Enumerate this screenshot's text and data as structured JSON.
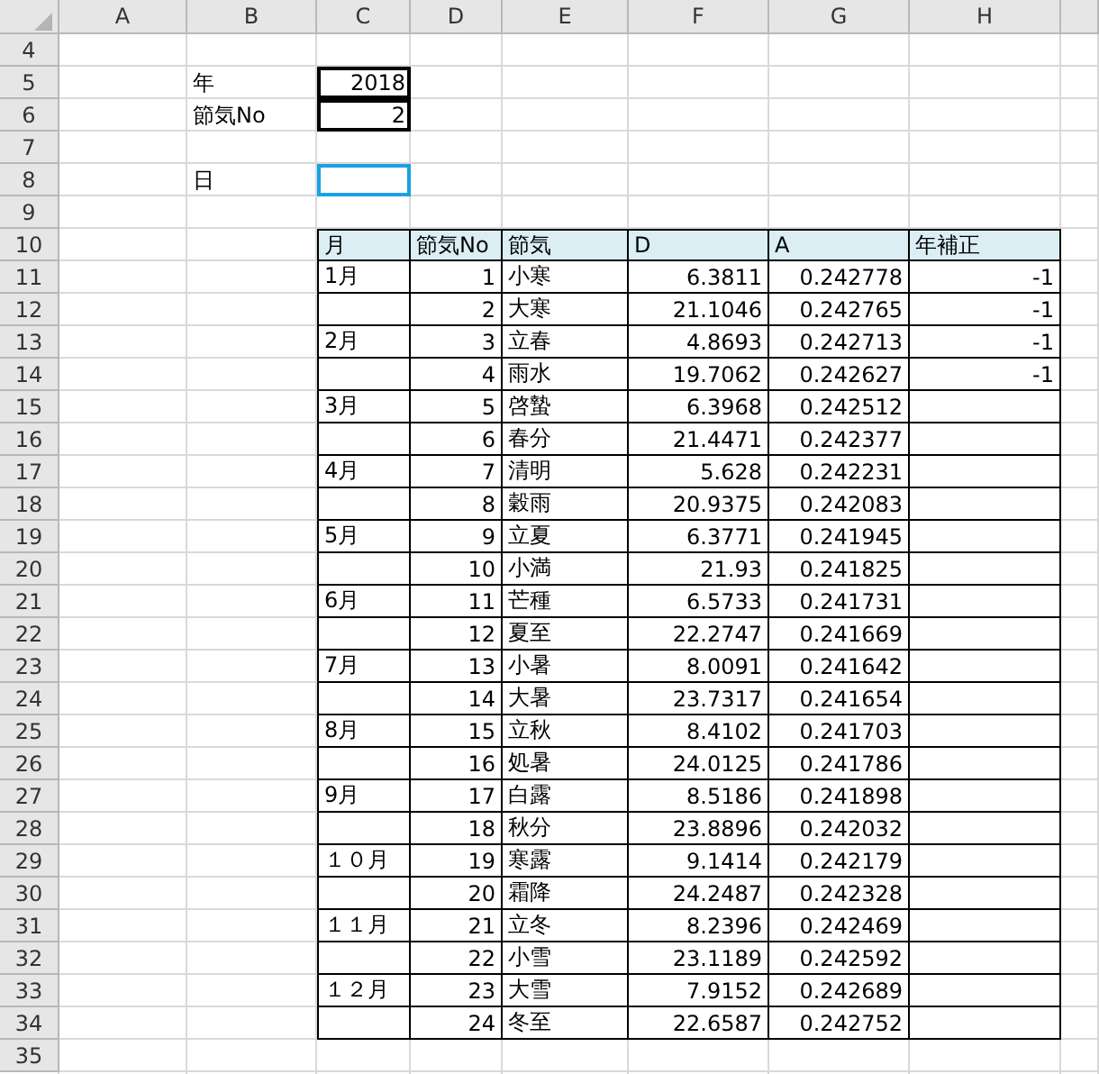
{
  "columns": [
    "A",
    "B",
    "C",
    "D",
    "E",
    "F",
    "G",
    "H"
  ],
  "row_numbers": [
    "4",
    "5",
    "6",
    "7",
    "8",
    "9",
    "10",
    "11",
    "12",
    "13",
    "14",
    "15",
    "16",
    "17",
    "18",
    "19",
    "20",
    "21",
    "22",
    "23",
    "24",
    "25",
    "26",
    "27",
    "28",
    "29",
    "30",
    "31",
    "32",
    "33",
    "34",
    "35"
  ],
  "inputs": [
    {
      "label": "年",
      "value": "2018"
    },
    {
      "label": "節気No",
      "value": "2"
    }
  ],
  "day": {
    "label": "日",
    "selected": true
  },
  "table": {
    "columns": [
      "月",
      "節気No",
      "節気",
      "D",
      "A",
      "年補正"
    ],
    "rows": [
      {
        "month": "1月",
        "no": "1",
        "name": "小寒",
        "d": "6.3811",
        "a": "0.242778",
        "year_correction": "-1"
      },
      {
        "no": "2",
        "name": "大寒",
        "d": "21.1046",
        "a": "0.242765",
        "year_correction": "-1"
      },
      {
        "month": "2月",
        "no": "3",
        "name": "立春",
        "d": "4.8693",
        "a": "0.242713",
        "year_correction": "-1"
      },
      {
        "no": "4",
        "name": "雨水",
        "d": "19.7062",
        "a": "0.242627",
        "year_correction": "-1"
      },
      {
        "month": "3月",
        "no": "5",
        "name": "啓蟄",
        "d": "6.3968",
        "a": "0.242512"
      },
      {
        "no": "6",
        "name": "春分",
        "d": "21.4471",
        "a": "0.242377"
      },
      {
        "month": "4月",
        "no": "7",
        "name": "清明",
        "d": "5.628",
        "a": "0.242231"
      },
      {
        "no": "8",
        "name": "穀雨",
        "d": "20.9375",
        "a": "0.242083"
      },
      {
        "month": "5月",
        "no": "9",
        "name": "立夏",
        "d": "6.3771",
        "a": "0.241945"
      },
      {
        "no": "10",
        "name": "小満",
        "d": "21.93",
        "a": "0.241825"
      },
      {
        "month": "6月",
        "no": "11",
        "name": "芒種",
        "d": "6.5733",
        "a": "0.241731"
      },
      {
        "no": "12",
        "name": "夏至",
        "d": "22.2747",
        "a": "0.241669"
      },
      {
        "month": "7月",
        "no": "13",
        "name": "小暑",
        "d": "8.0091",
        "a": "0.241642"
      },
      {
        "no": "14",
        "name": "大暑",
        "d": "23.7317",
        "a": "0.241654"
      },
      {
        "month": "8月",
        "no": "15",
        "name": "立秋",
        "d": "8.4102",
        "a": "0.241703"
      },
      {
        "no": "16",
        "name": "処暑",
        "d": "24.0125",
        "a": "0.241786"
      },
      {
        "month": "9月",
        "no": "17",
        "name": "白露",
        "d": "8.5186",
        "a": "0.241898"
      },
      {
        "no": "18",
        "name": "秋分",
        "d": "23.8896",
        "a": "0.242032"
      },
      {
        "month": "１０月",
        "no": "19",
        "name": "寒露",
        "d": "9.1414",
        "a": "0.242179"
      },
      {
        "no": "20",
        "name": "霜降",
        "d": "24.2487",
        "a": "0.242328"
      },
      {
        "month": "１１月",
        "no": "21",
        "name": "立冬",
        "d": "8.2396",
        "a": "0.242469"
      },
      {
        "no": "22",
        "name": "小雪",
        "d": "23.1189",
        "a": "0.242592"
      },
      {
        "month": "１２月",
        "no": "23",
        "name": "大雪",
        "d": "7.9152",
        "a": "0.242689"
      },
      {
        "no": "24",
        "name": "冬至",
        "d": "22.6587",
        "a": "0.242752"
      }
    ]
  }
}
